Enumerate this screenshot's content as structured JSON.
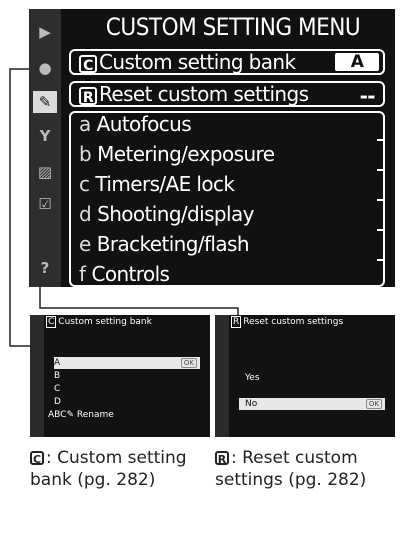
{
  "menu": {
    "title": "CUSTOM SETTING MENU",
    "bank_row": {
      "icon": "C",
      "label": "Custom setting bank",
      "value": "A"
    },
    "reset_row": {
      "icon": "R",
      "label": "Reset custom settings",
      "value": "--"
    },
    "groups": [
      {
        "letter": "a",
        "label": "Autofocus"
      },
      {
        "letter": "b",
        "label": "Metering/exposure"
      },
      {
        "letter": "c",
        "label": "Timers/AE lock"
      },
      {
        "letter": "d",
        "label": "Shooting/display"
      },
      {
        "letter": "e",
        "label": "Bracketing/flash"
      },
      {
        "letter": "f",
        "label": "Controls"
      }
    ],
    "sidebar_help": "?"
  },
  "thumb_bank": {
    "title_icon": "C",
    "title": "Custom setting bank",
    "items": [
      "A",
      "B",
      "C",
      "D"
    ],
    "rename": "ABC✎ Rename",
    "ok": "OK"
  },
  "thumb_reset": {
    "title_icon": "R",
    "title": "Reset custom settings",
    "yes": "Yes",
    "no": "No",
    "ok": "OK"
  },
  "captions": {
    "bank_icon": "C",
    "bank_text": ": Custom setting bank (pg. 282)",
    "reset_icon": "R",
    "reset_text": ": Reset custom settings (pg. 282)"
  }
}
